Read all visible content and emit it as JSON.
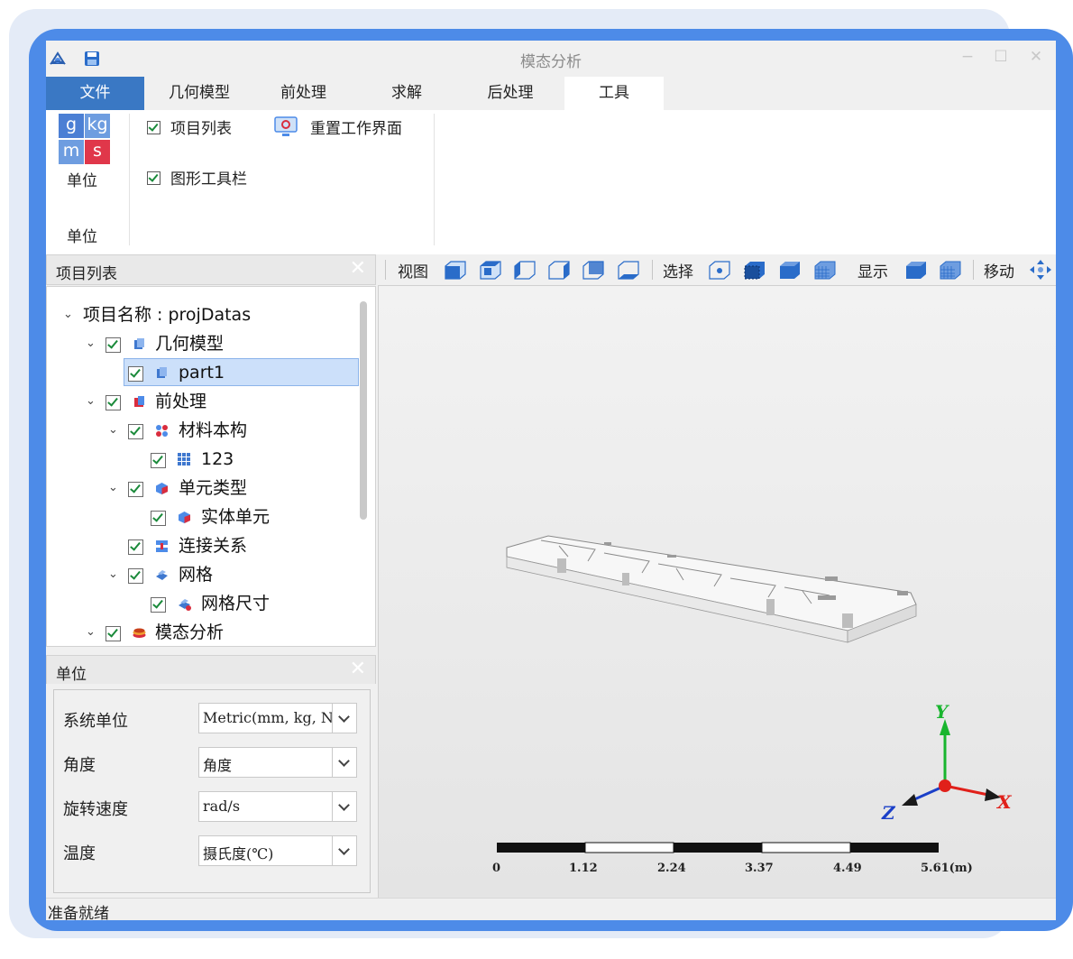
{
  "window": {
    "title": "模态分析",
    "minimize": "−",
    "maximize": "☐",
    "close": "✕"
  },
  "tabs": [
    {
      "label": "文件"
    },
    {
      "label": "几何模型"
    },
    {
      "label": "前处理"
    },
    {
      "label": "求解"
    },
    {
      "label": "后处理"
    },
    {
      "label": "工具"
    }
  ],
  "ribbon": {
    "unit_icon_cells": [
      "g",
      "kg",
      "m",
      "s"
    ],
    "unit_button_label": "单位",
    "unit_group_label": "单位",
    "project_list_check": "项目列表",
    "graphic_toolbar_check": "图形工具栏",
    "reset_workspace": "重置工作界面"
  },
  "project_panel": {
    "title": "项目列表",
    "close": "✕",
    "tree": {
      "root": "项目名称 : projDatas",
      "geometry": "几何模型",
      "part": "part1",
      "preprocess": "前处理",
      "material": "材料本构",
      "material_item": "123",
      "element_type": "单元类型",
      "solid_element": "实体单元",
      "connection": "连接关系",
      "mesh": "网格",
      "mesh_size": "网格尺寸",
      "modal": "模态分析"
    }
  },
  "unit_panel": {
    "title": "单位",
    "close": "✕",
    "rows": [
      {
        "label": "系统单位",
        "value": "Metric(mm, kg, N, s)"
      },
      {
        "label": "角度",
        "value": "角度"
      },
      {
        "label": "旋转速度",
        "value": "rad/s"
      },
      {
        "label": "温度",
        "value": "摄氏度(℃)"
      }
    ]
  },
  "viewport_toolbar": {
    "view_label": "视图",
    "select_label": "选择",
    "display_label": "显示",
    "move_label": "移动"
  },
  "viewport": {
    "scale_labels": [
      "0",
      "1.12",
      "2.24",
      "3.37",
      "4.49",
      "5.61(m)"
    ],
    "axes": {
      "x": "X",
      "y": "Y",
      "z": "Z"
    }
  },
  "colors": {
    "accent": "#3a78c4",
    "frame": "#4d8be8",
    "selection": "#cce0fa",
    "axis_x": "#e0201a",
    "axis_y": "#18b52e",
    "axis_z": "#1a3fc8"
  },
  "status": {
    "text": "准备就绪"
  }
}
